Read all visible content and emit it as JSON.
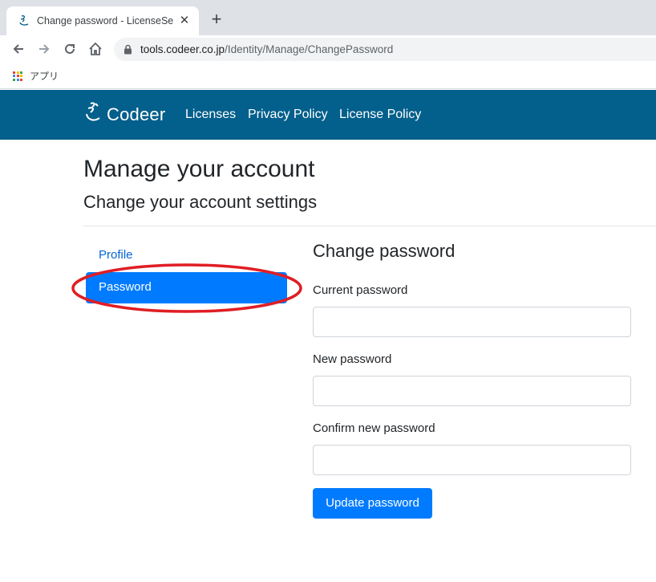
{
  "browser": {
    "tab_title": "Change password - LicenseServer",
    "tab_close": "✕",
    "new_tab": "+",
    "url_host": "tools.codeer.co.jp",
    "url_path": "/Identity/Manage/ChangePassword",
    "bookmark_apps_label": "アプリ"
  },
  "navbar": {
    "brand": "Codeer",
    "links": [
      "Licenses",
      "Privacy Policy",
      "License Policy"
    ],
    "color": "#035f8b"
  },
  "page": {
    "title": "Manage your account",
    "subtitle": "Change your account settings"
  },
  "sidebar": {
    "items": [
      {
        "label": "Profile",
        "active": false
      },
      {
        "label": "Password",
        "active": true
      }
    ],
    "highlight_color": "#e01e24"
  },
  "form": {
    "title": "Change password",
    "fields": [
      {
        "label": "Current password",
        "value": "",
        "placeholder": ""
      },
      {
        "label": "New password",
        "value": "",
        "placeholder": ""
      },
      {
        "label": "Confirm new password",
        "value": "",
        "placeholder": ""
      }
    ],
    "submit_label": "Update password",
    "accent": "#007bff"
  },
  "icons": [
    "codeer-favicon-icon",
    "close-icon",
    "plus-icon",
    "back-arrow-icon",
    "forward-arrow-icon",
    "reload-icon",
    "home-icon",
    "lock-icon",
    "apps-grid-icon",
    "codeer-logo-icon"
  ]
}
